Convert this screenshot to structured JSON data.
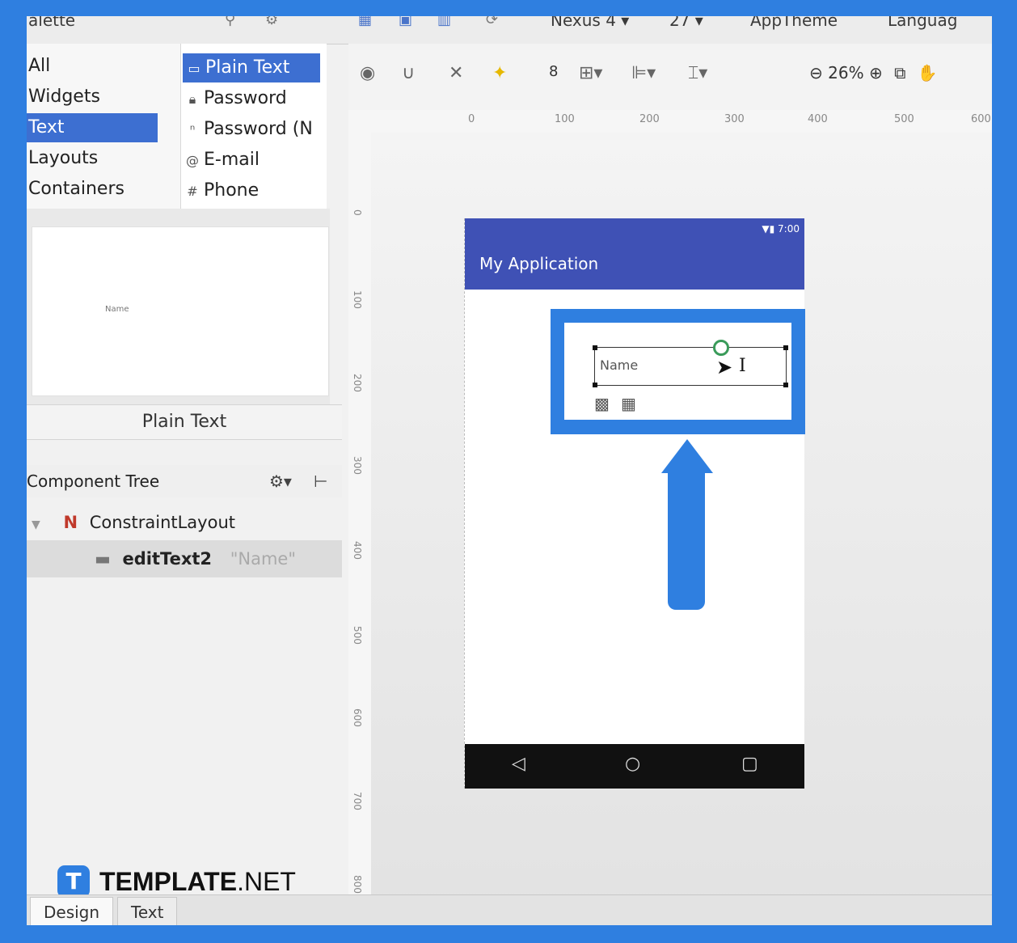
{
  "topbar": {
    "palette_title": "alette",
    "device": "Nexus 4",
    "api": "27",
    "theme": "AppTheme",
    "language": "Languag"
  },
  "palette": {
    "categories": [
      {
        "label": "All"
      },
      {
        "label": "Widgets"
      },
      {
        "label": "Text",
        "selected": true
      },
      {
        "label": "Layouts"
      },
      {
        "label": "Containers"
      }
    ],
    "items": [
      {
        "label": "Plain Text",
        "selected": true,
        "icon": "text-field-icon"
      },
      {
        "label": "Password",
        "icon": "lock-icon"
      },
      {
        "label": "Password (N",
        "icon": "lock-numeric-icon"
      },
      {
        "label": "E-mail",
        "icon": "at-icon"
      },
      {
        "label": "Phone",
        "icon": "hash-icon"
      }
    ]
  },
  "preview": {
    "text": "Name",
    "label": "Plain Text"
  },
  "component_tree": {
    "title": "Component Tree",
    "rows": [
      {
        "label": "ConstraintLayout",
        "icon": "constraint-layout-icon"
      },
      {
        "label": "editText2",
        "hint": "\"Name\"",
        "icon": "edittext-icon"
      }
    ]
  },
  "design": {
    "zoom": "26%",
    "hruler_ticks": [
      "0",
      "100",
      "200",
      "300",
      "400",
      "500",
      "600"
    ],
    "vruler_ticks": [
      "0",
      "100",
      "200",
      "300",
      "400",
      "500",
      "600",
      "700",
      "800"
    ],
    "status_time": "7:00",
    "app_title": "My Application",
    "edittext_hint": "Name"
  },
  "watermark": {
    "brand_bold": "TEMPLATE",
    "brand_rest": ".NET"
  },
  "tabs": [
    {
      "label": "Design",
      "selected": true
    },
    {
      "label": "Text"
    }
  ],
  "colors": {
    "accent": "#2f7fe0",
    "selection": "#3d6fd1",
    "app_bar": "#3f51b5",
    "nav_bar": "#111111"
  }
}
